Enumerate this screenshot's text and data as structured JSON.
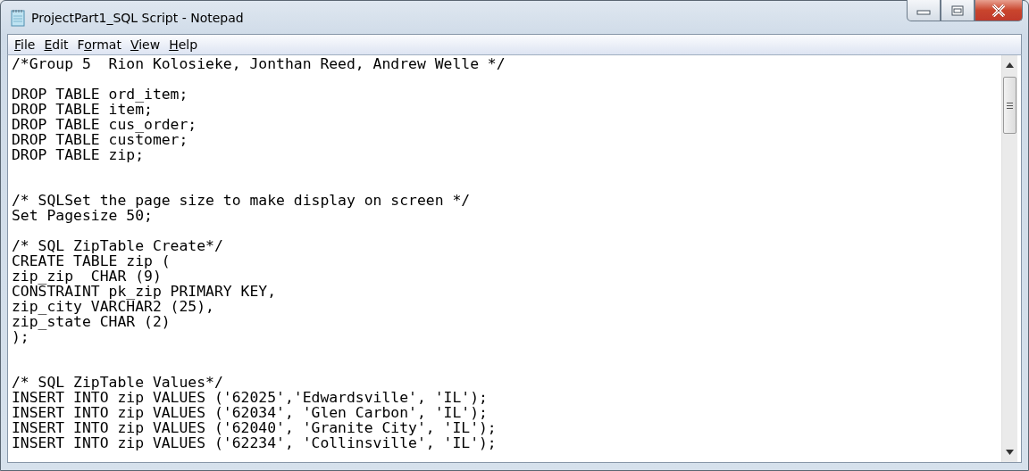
{
  "window": {
    "title": "ProjectPart1_SQL Script - Notepad"
  },
  "menu": [
    {
      "key": "F",
      "post": "ile"
    },
    {
      "key": "E",
      "post": "dit"
    },
    {
      "pre": "F",
      "key": "o",
      "post": "rmat"
    },
    {
      "key": "V",
      "post": "iew"
    },
    {
      "key": "H",
      "post": "elp"
    }
  ],
  "editor": {
    "blocks": [
      {
        "blank_line_before": false,
        "second_blank_line": false,
        "lines": [
          "/*Group 5  Rion Kolosieke, Jonthan Reed, Andrew Welle */"
        ]
      },
      {
        "blank_line_before": true,
        "second_blank_line": false,
        "lines": [
          "DROP TABLE ord_item;",
          "DROP TABLE item;",
          "DROP TABLE cus_order;",
          "DROP TABLE customer;",
          "DROP TABLE zip;"
        ]
      },
      {
        "blank_line_before": true,
        "second_blank_line": true,
        "lines": [
          "/* SQLSet the page size to make display on screen */",
          "Set Pagesize 50;"
        ]
      },
      {
        "blank_line_before": true,
        "second_blank_line": false,
        "lines": [
          "/* SQL ZipTable Create*/",
          "CREATE TABLE zip (",
          "zip_zip  CHAR (9)",
          "CONSTRAINT pk_zip PRIMARY KEY,",
          "zip_city VARCHAR2 (25),",
          "zip_state CHAR (2)",
          ");"
        ]
      },
      {
        "blank_line_before": true,
        "second_blank_line": true,
        "lines": [
          "/* SQL ZipTable Values*/",
          "INSERT INTO zip VALUES ('62025','Edwardsville', 'IL');",
          "INSERT INTO zip VALUES ('62034', 'Glen Carbon', 'IL');",
          "INSERT INTO zip VALUES ('62040', 'Granite City', 'IL');",
          "INSERT INTO zip VALUES ('62234', 'Collinsville', 'IL');"
        ]
      }
    ]
  }
}
